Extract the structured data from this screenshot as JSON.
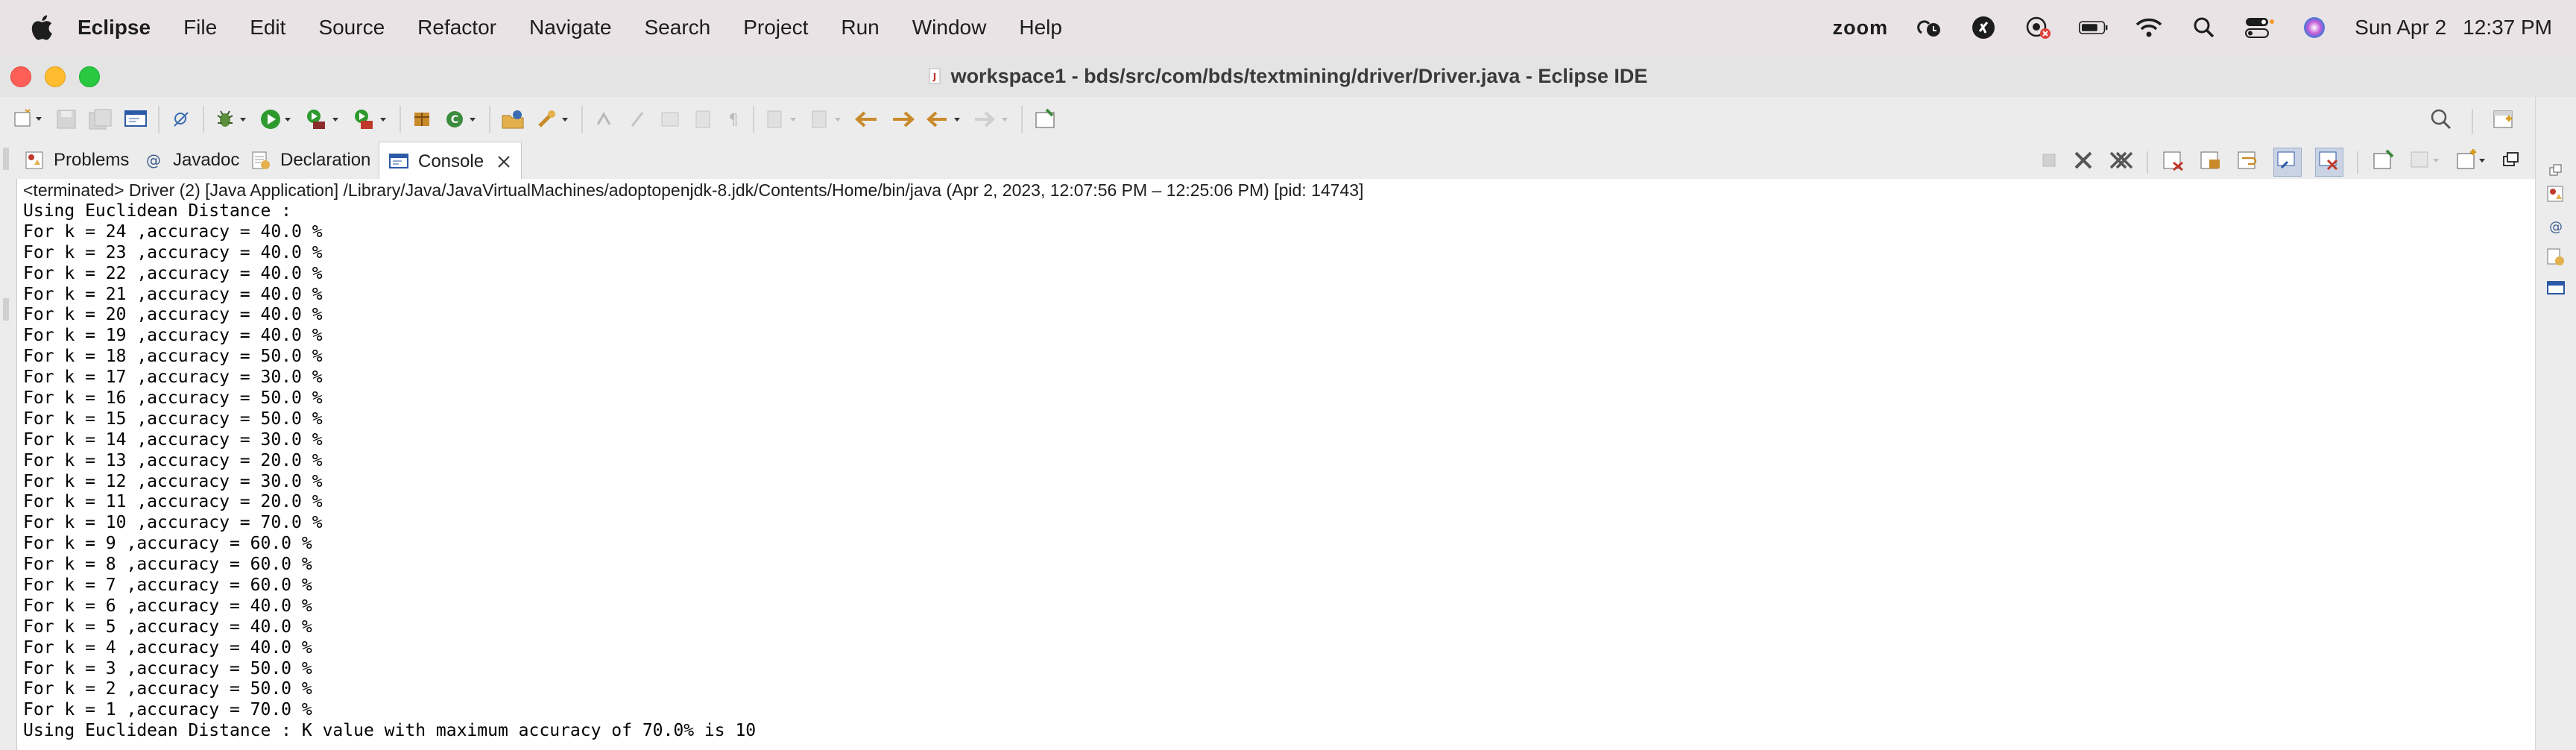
{
  "menubar": {
    "app": "Eclipse",
    "items": [
      "File",
      "Edit",
      "Source",
      "Refactor",
      "Navigate",
      "Search",
      "Project",
      "Run",
      "Window",
      "Help"
    ],
    "status": {
      "zoom": "zoom",
      "date": "Sun Apr 2",
      "time": "12:37 PM"
    }
  },
  "window": {
    "title": "workspace1 - bds/src/com/bds/textmining/driver/Driver.java - Eclipse IDE"
  },
  "tabs": [
    {
      "label": "Problems",
      "icon": "problems-icon"
    },
    {
      "label": "Javadoc",
      "icon": "javadoc-icon"
    },
    {
      "label": "Declaration",
      "icon": "declaration-icon"
    },
    {
      "label": "Console",
      "icon": "console-icon",
      "active": true
    }
  ],
  "console": {
    "launch": "<terminated> Driver (2) [Java Application] /Library/Java/JavaVirtualMachines/adoptopenjdk-8.jdk/Contents/Home/bin/java  (Apr 2, 2023, 12:07:56 PM – 12:25:06 PM) [pid: 14743]",
    "lines": [
      "Using Euclidean Distance :",
      "For k = 24 ,accuracy = 40.0 %",
      "For k = 23 ,accuracy = 40.0 %",
      "For k = 22 ,accuracy = 40.0 %",
      "For k = 21 ,accuracy = 40.0 %",
      "For k = 20 ,accuracy = 40.0 %",
      "For k = 19 ,accuracy = 40.0 %",
      "For k = 18 ,accuracy = 50.0 %",
      "For k = 17 ,accuracy = 30.0 %",
      "For k = 16 ,accuracy = 50.0 %",
      "For k = 15 ,accuracy = 50.0 %",
      "For k = 14 ,accuracy = 30.0 %",
      "For k = 13 ,accuracy = 20.0 %",
      "For k = 12 ,accuracy = 30.0 %",
      "For k = 11 ,accuracy = 20.0 %",
      "For k = 10 ,accuracy = 70.0 %",
      "For k = 9 ,accuracy = 60.0 %",
      "For k = 8 ,accuracy = 60.0 %",
      "For k = 7 ,accuracy = 60.0 %",
      "For k = 6 ,accuracy = 40.0 %",
      "For k = 5 ,accuracy = 40.0 %",
      "For k = 4 ,accuracy = 40.0 %",
      "For k = 3 ,accuracy = 50.0 %",
      "For k = 2 ,accuracy = 50.0 %",
      "For k = 1 ,accuracy = 70.0 %",
      "Using Euclidean Distance : K value with maximum accuracy of 70.0% is 10"
    ]
  },
  "colors": {
    "close": "#ff5f57",
    "minimize": "#febc2e",
    "maximize": "#28c840",
    "run_green": "#2e9a2e"
  }
}
